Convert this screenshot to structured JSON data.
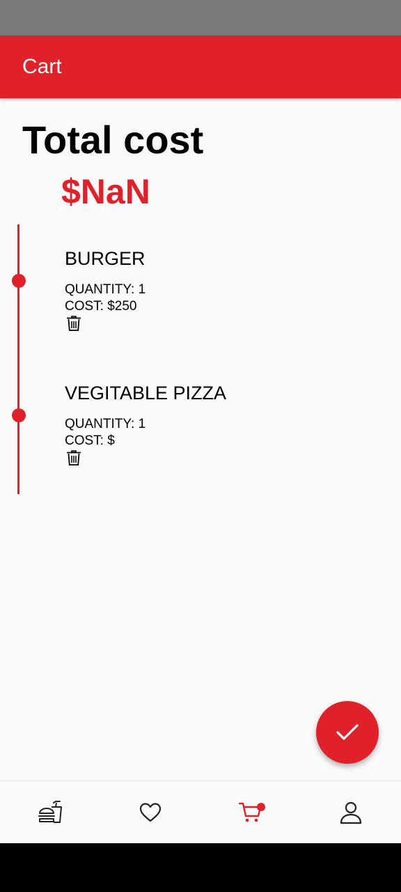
{
  "app_bar": {
    "title": "Cart"
  },
  "summary": {
    "total_label": "Total cost",
    "total_value": "$NaN"
  },
  "cart": {
    "items": [
      {
        "name": "BURGER",
        "quantity": "QUANTITY: 1",
        "cost": "COST: $250"
      },
      {
        "name": "VEGITABLE PIZZA",
        "quantity": "QUANTITY: 1",
        "cost": "COST: $"
      }
    ]
  },
  "fab": {
    "icon": "check-icon"
  },
  "bottom_nav": {
    "items": [
      {
        "icon": "food-icon",
        "active": false
      },
      {
        "icon": "heart-icon",
        "active": false
      },
      {
        "icon": "cart-icon",
        "active": true,
        "badge": true
      },
      {
        "icon": "person-icon",
        "active": false
      }
    ]
  },
  "colors": {
    "accent": "#e02129",
    "status_bar": "#7a7a7a",
    "background": "#fafafa"
  }
}
